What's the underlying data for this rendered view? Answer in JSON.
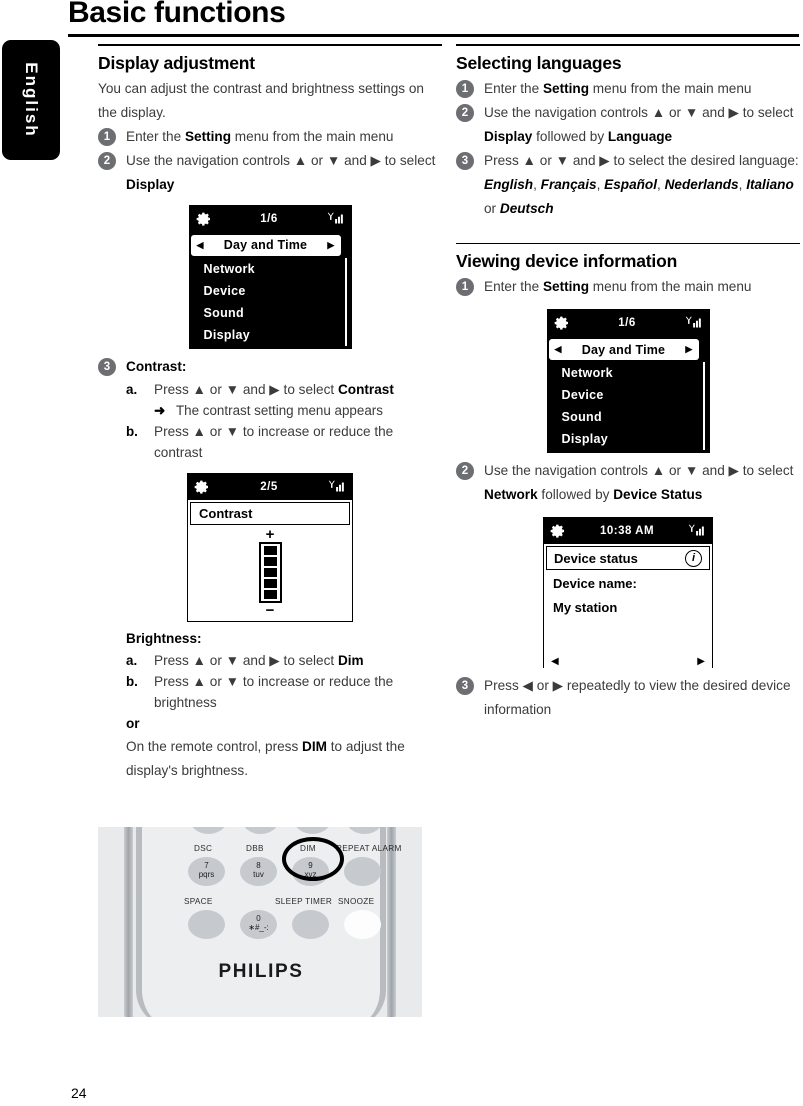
{
  "page": {
    "title": "Basic functions",
    "side_tab": "English",
    "number": "24"
  },
  "left_column": {
    "section1": {
      "heading": "Display adjustment",
      "intro": "You can adjust the contrast and brightness settings on the display.",
      "steps": [
        {
          "num": "1",
          "text_prefix": "Enter the ",
          "bold1": "Setting",
          "text_suffix": " menu from the main menu"
        },
        {
          "num": "2",
          "text_prefix": "Use the navigation controls ▲ or ▼ and ▶ to select ",
          "bold1": "Display",
          "text_suffix": ""
        }
      ],
      "screen_menu": {
        "status_page": "1/6",
        "gear_icon": "gear-icon",
        "signal_icon": "signal-bars-icon",
        "selected_item": "Day and Time",
        "left_arrow": "◀",
        "right_arrow": "▶",
        "items": [
          "Network",
          "Device",
          "Sound",
          "Display"
        ]
      },
      "step3": {
        "num": "3",
        "title": "Contrast:",
        "a_label": "a.",
        "a_text_prefix": "Press ▲ or ▼ and ▶ to select ",
        "a_bold": "Contrast",
        "a_note_arrow": "➜",
        "a_note": "The contrast setting menu appears",
        "b_label": "b.",
        "b_text": "Press ▲ or ▼ to increase or reduce the contrast"
      },
      "screen_contrast": {
        "status_page": "2/5",
        "title": "Contrast",
        "plus": "+",
        "minus": "−",
        "segments_filled": 5
      },
      "brightness": {
        "title": "Brightness:",
        "a_label": "a.",
        "a_text_prefix": "Press ▲ or ▼ and ▶ to select ",
        "a_bold": "Dim",
        "b_label": "b.",
        "b_text": "Press ▲ or ▼ to increase or reduce the brightness",
        "or": "or",
        "remote_text_prefix": "On the remote control, press ",
        "remote_bold": "DIM",
        "remote_text_suffix": " to adjust the display's brightness."
      }
    },
    "remote": {
      "brand": "PHILIPS",
      "labels": [
        "DSC",
        "DBB",
        "DIM",
        "REPEAT ALARM",
        "SPACE",
        "SLEEP TIMER",
        "SNOOZE"
      ],
      "keys": [
        {
          "digit": "7",
          "letters": "pqrs"
        },
        {
          "digit": "8",
          "letters": "tuv"
        },
        {
          "digit": "9",
          "letters": "xyz"
        },
        {
          "digit": "0",
          "letters": "∗#_-:"
        }
      ],
      "highlighted_key": "DIM"
    }
  },
  "right_column": {
    "section_languages": {
      "heading": "Selecting languages",
      "steps": [
        {
          "num": "1",
          "prefix": "Enter the ",
          "bold": "Setting",
          "suffix": " menu from the main menu"
        },
        {
          "num": "2",
          "prefix": "Use the navigation controls ▲ or ▼ and ▶ to select ",
          "bold": "Display",
          "mid": " followed by ",
          "bold2": "Language"
        },
        {
          "num": "3",
          "prefix": "Press ▲ or ▼ and ▶ to select the desired language: ",
          "languages": [
            "English",
            "Français",
            "Español",
            "Nederlands",
            "Italiano"
          ],
          "last_sep": " or ",
          "last_language": "Deutsch"
        }
      ]
    },
    "section_device_info": {
      "heading": "Viewing device information",
      "step1": {
        "num": "1",
        "prefix": "Enter the ",
        "bold": "Setting",
        "suffix": " menu from the main menu"
      },
      "screen_menu": {
        "status_page": "1/6",
        "selected_item": "Day and Time",
        "left_arrow": "◀",
        "right_arrow": "▶",
        "items": [
          "Network",
          "Device",
          "Sound",
          "Display"
        ]
      },
      "step2": {
        "num": "2",
        "prefix": "Use the navigation controls ▲ or ▼ and ▶ to select ",
        "bold": "Network",
        "mid": " followed by ",
        "bold2": "Device Status"
      },
      "screen_status": {
        "status_time": "10:38 AM",
        "row_title": "Device status",
        "info_icon": "i",
        "line1": "Device name:",
        "line2": "My station",
        "left_arrow": "◀",
        "right_arrow": "▶"
      },
      "step3": {
        "num": "3",
        "text": "Press ◀ or ▶ repeatedly to view the desired device information"
      }
    }
  }
}
